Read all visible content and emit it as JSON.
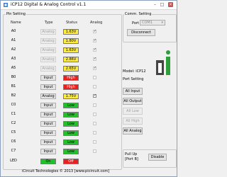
{
  "window": {
    "title": "iCP12 Digital & Analog Control v1.1",
    "minimize": "–",
    "maximize": "□",
    "close": "×"
  },
  "pin_setting": {
    "caption": "Pin Setting",
    "headers": {
      "name": "Name",
      "type": "Type",
      "status": "Status",
      "analog": "Analog"
    },
    "rows": [
      {
        "name": "A0",
        "type": "Analog",
        "type_enabled": false,
        "value": "1.63V",
        "color": "#ffeb3b",
        "analog_checked": true,
        "analog_enabled": false
      },
      {
        "name": "A1",
        "type": "Analog",
        "type_enabled": false,
        "value": "1.80V",
        "color": "#ffeb3b",
        "analog_checked": true,
        "analog_enabled": false
      },
      {
        "name": "A2",
        "type": "Analog",
        "type_enabled": false,
        "value": "1.63V",
        "color": "#ffeb3b",
        "analog_checked": true,
        "analog_enabled": false
      },
      {
        "name": "A3",
        "type": "Analog",
        "type_enabled": false,
        "value": "2.86V",
        "color": "#ffeb3b",
        "analog_checked": true,
        "analog_enabled": false
      },
      {
        "name": "A5",
        "type": "Analog",
        "type_enabled": false,
        "value": "2.65V",
        "color": "#ffeb3b",
        "analog_checked": true,
        "analog_enabled": false
      },
      {
        "name": "B0",
        "type": "Input",
        "type_enabled": true,
        "value": "High",
        "color": "#e82020",
        "analog_checked": false,
        "analog_enabled": false
      },
      {
        "name": "B1",
        "type": "Input",
        "type_enabled": true,
        "value": "High",
        "color": "#e82020",
        "analog_checked": false,
        "analog_enabled": false
      },
      {
        "name": "B2",
        "type": "Analog",
        "type_enabled": true,
        "value": "1.75V",
        "color": "#ffeb3b",
        "analog_checked": true,
        "analog_enabled": true
      },
      {
        "name": "C0",
        "type": "Input",
        "type_enabled": true,
        "value": "Low",
        "color": "#22c02a",
        "analog_checked": false,
        "analog_enabled": false
      },
      {
        "name": "C1",
        "type": "Input",
        "type_enabled": true,
        "value": "Low",
        "color": "#22c02a",
        "analog_checked": false,
        "analog_enabled": false
      },
      {
        "name": "C2",
        "type": "Input",
        "type_enabled": true,
        "value": "Low",
        "color": "#22c02a",
        "analog_checked": false,
        "analog_enabled": false
      },
      {
        "name": "C5",
        "type": "Input",
        "type_enabled": true,
        "value": "Low",
        "color": "#22c02a",
        "analog_checked": false,
        "analog_enabled": false
      },
      {
        "name": "C6",
        "type": "Input",
        "type_enabled": true,
        "value": "Low",
        "color": "#22c02a",
        "analog_checked": false,
        "analog_enabled": false
      },
      {
        "name": "C7",
        "type": "Input",
        "type_enabled": true,
        "value": "Low",
        "color": "#22c02a",
        "analog_checked": false,
        "analog_enabled": false
      }
    ],
    "led": {
      "name": "LED",
      "on_label": "On",
      "on_color": "#22c02a",
      "off_label": "Off",
      "off_color": "#e82020"
    }
  },
  "comm_setting": {
    "caption": "Comm. Setting",
    "port_label": "Port",
    "port_value": "COM1",
    "disconnect_label": "Disconnect",
    "model_label": "Model: iCP12"
  },
  "port_setting": {
    "caption": "Port Setting",
    "all_input": "All Input",
    "all_output": "All Output",
    "all_low": "All Low",
    "all_high": "All High",
    "all_analog": "All Analog"
  },
  "pullup": {
    "label_line1": "Pull Up",
    "label_line2": "[Port B]",
    "disable_label": "Disable"
  },
  "footer": {
    "text": "iCircuit Technologies © 2013 [www.picircuit.com]"
  },
  "colors": {
    "accent_green": "#2e9e3a",
    "high_red": "#e82020",
    "low_green": "#22c02a",
    "analog_yellow": "#ffeb3b"
  }
}
